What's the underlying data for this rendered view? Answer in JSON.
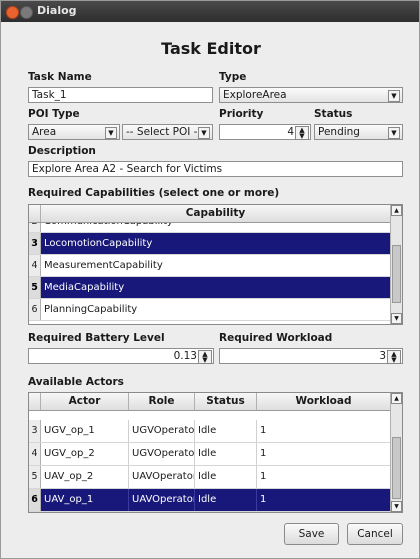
{
  "window": {
    "title": "Dialog"
  },
  "heading": "Task Editor",
  "task_name": {
    "label": "Task Name",
    "value": "Task_1"
  },
  "type": {
    "label": "Type",
    "value": "ExploreArea"
  },
  "poi_type": {
    "label": "POI Type",
    "value": "Area",
    "poi_value": "-- Select POI --"
  },
  "priority": {
    "label": "Priority",
    "value": "4"
  },
  "status": {
    "label": "Status",
    "value": "Pending"
  },
  "description": {
    "label": "Description",
    "value": "Explore Area A2 - Search for Victims"
  },
  "capabilities": {
    "label": "Required Capabilities (select one or more)",
    "header": "Capability",
    "rows": [
      {
        "n": "2",
        "name": "CommunicationCapability",
        "selected": false
      },
      {
        "n": "3",
        "name": "LocomotionCapability",
        "selected": true
      },
      {
        "n": "4",
        "name": "MeasurementCapability",
        "selected": false
      },
      {
        "n": "5",
        "name": "MediaCapability",
        "selected": true
      },
      {
        "n": "6",
        "name": "PlanningCapability",
        "selected": false
      }
    ]
  },
  "battery": {
    "label": "Required Battery Level",
    "value": "0.13"
  },
  "workload": {
    "label": "Required Workload",
    "value": "3"
  },
  "actors": {
    "label": "Available Actors",
    "headers": [
      "Actor",
      "Role",
      "Status",
      "Workload"
    ],
    "rows": [
      {
        "n": "3",
        "actor": "UGV_op_1",
        "role": "UGVOperator",
        "status": "Idle",
        "workload": "1",
        "selected": false
      },
      {
        "n": "4",
        "actor": "UGV_op_2",
        "role": "UGVOperator",
        "status": "Idle",
        "workload": "1",
        "selected": false
      },
      {
        "n": "5",
        "actor": "UAV_op_2",
        "role": "UAVOperator",
        "status": "Idle",
        "workload": "1",
        "selected": false
      },
      {
        "n": "6",
        "actor": "UAV_op_1",
        "role": "UAVOperator",
        "status": "Idle",
        "workload": "1",
        "selected": true
      }
    ]
  },
  "buttons": {
    "save": "Save",
    "cancel": "Cancel"
  },
  "colors": {
    "selection": "#17187a",
    "close_dot": "#e8632d"
  },
  "icons": {
    "spin": "spin-arrows-icon",
    "combo": "chevron-down-icon"
  }
}
